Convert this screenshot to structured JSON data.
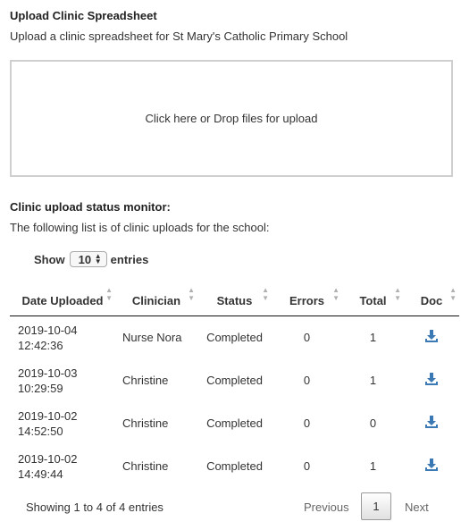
{
  "upload": {
    "title": "Upload Clinic Spreadsheet",
    "subtitle": "Upload a clinic spreadsheet for St Mary's Catholic Primary School",
    "dropzone_label": "Click here or Drop files for upload"
  },
  "monitor": {
    "title": "Clinic upload status monitor:",
    "subtitle": "The following list is of clinic uploads for the school:"
  },
  "length": {
    "prefix": "Show",
    "value": "10",
    "suffix": "entries"
  },
  "table": {
    "headers": {
      "date": "Date Uploaded",
      "clinician": "Clinician",
      "status": "Status",
      "errors": "Errors",
      "total": "Total",
      "doc": "Doc"
    },
    "rows": [
      {
        "date": "2019-10-04",
        "time": "12:42:36",
        "clinician": "Nurse Nora",
        "status": "Completed",
        "errors": "0",
        "total": "1",
        "doc_icon": "download-icon"
      },
      {
        "date": "2019-10-03",
        "time": "10:29:59",
        "clinician": "Christine",
        "status": "Completed",
        "errors": "0",
        "total": "1",
        "doc_icon": "download-icon"
      },
      {
        "date": "2019-10-02",
        "time": "14:52:50",
        "clinician": "Christine",
        "status": "Completed",
        "errors": "0",
        "total": "0",
        "doc_icon": "download-icon"
      },
      {
        "date": "2019-10-02",
        "time": "14:49:44",
        "clinician": "Christine",
        "status": "Completed",
        "errors": "0",
        "total": "1",
        "doc_icon": "download-icon"
      }
    ]
  },
  "footer": {
    "info": "Showing 1 to 4 of 4 entries",
    "previous": "Previous",
    "current_page": "1",
    "next": "Next"
  },
  "colors": {
    "download_icon": "#3a79b4",
    "sort_arrow": "#b0b0b0"
  }
}
